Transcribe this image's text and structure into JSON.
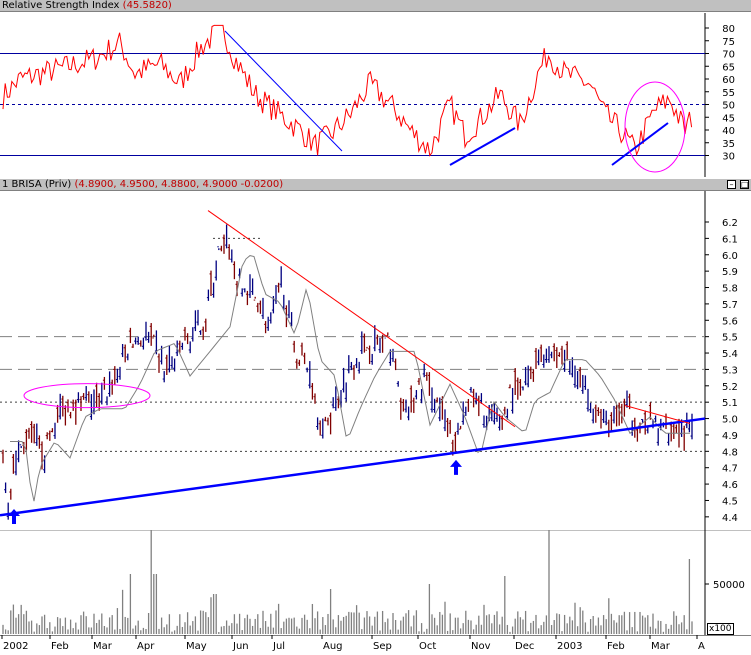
{
  "rsi_pane": {
    "title": "Relative Strength Index",
    "value": "(45.5820)",
    "axis_ticks": [
      "80",
      "75",
      "70",
      "65",
      "60",
      "55",
      "50",
      "45",
      "40",
      "35",
      "30"
    ]
  },
  "price_pane": {
    "title": "1 BRISA (Priv)",
    "ohlc": "(4.8900, 4.9500, 4.8800, 4.9000 -0.0200)",
    "axis_ticks": [
      "6.2",
      "6.1",
      "6.0",
      "5.9",
      "5.8",
      "5.7",
      "5.6",
      "5.5",
      "5.4",
      "5.3",
      "5.2",
      "5.1",
      "5.0",
      "4.9",
      "4.8",
      "4.7",
      "4.6",
      "4.5",
      "4.4"
    ]
  },
  "volume_pane": {
    "axis_ticks": [
      "50000"
    ],
    "scale_label": "x100"
  },
  "x_axis": {
    "labels": [
      "2002",
      "Feb",
      "Mar",
      "Apr",
      "May",
      "Jun",
      "Jul",
      "Aug",
      "Sep",
      "Oct",
      "Nov",
      "Dec",
      "2003",
      "Feb",
      "Mar",
      "A"
    ]
  },
  "colors": {
    "rsi_line": "#ff0000",
    "trend_line": "#0000ff",
    "resistance_line": "#ff0000",
    "ellipse": "#ff00ff",
    "up_bar": "#000080",
    "down_bar": "#800000",
    "volume_bar": "#808080"
  },
  "icons": {
    "pane_controls": [
      "minimize-icon",
      "maximize-icon"
    ]
  }
}
